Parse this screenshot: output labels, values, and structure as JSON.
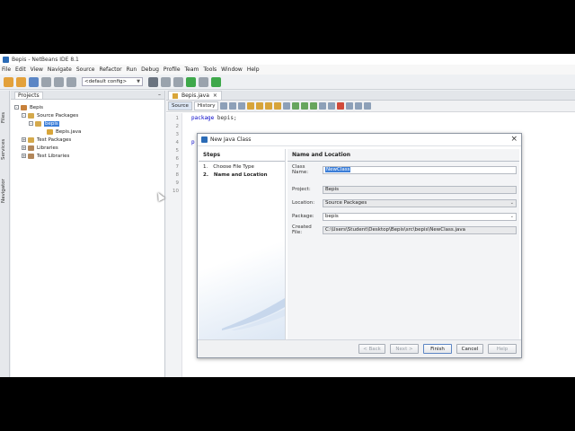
{
  "window": {
    "title": "Bepis - NetBeans IDE 8.1"
  },
  "menu": [
    "File",
    "Edit",
    "View",
    "Navigate",
    "Source",
    "Refactor",
    "Run",
    "Debug",
    "Profile",
    "Team",
    "Tools",
    "Window",
    "Help"
  ],
  "toolbar": {
    "config": "<default config>"
  },
  "side_tabs": {
    "files": "Files",
    "services": "Services",
    "navigator": "Navigator"
  },
  "projects": {
    "tab_label": "Projects",
    "tree": {
      "root": "Bepis",
      "source_packages": "Source Packages",
      "package": "bepis",
      "file": "Bepis.java",
      "test_packages": "Test Packages",
      "libraries": "Libraries",
      "test_libraries": "Test Libraries"
    }
  },
  "editor": {
    "tab": "Bepis.java",
    "mode_source": "Source",
    "mode_history": "History",
    "line_numbers": [
      "1",
      "2",
      "3",
      "4",
      "5",
      "6",
      "7",
      "8",
      "9",
      "10"
    ],
    "line1_kw": "package",
    "line1_rest": " bepis;",
    "line4_frag": "p"
  },
  "dialog": {
    "title": "New Java Class",
    "steps_header": "Steps",
    "steps": [
      {
        "num": "1.",
        "label": "Choose File Type"
      },
      {
        "num": "2.",
        "label": "Name and Location"
      }
    ],
    "panel_header": "Name and Location",
    "fields": {
      "class_name_label": "Class Name:",
      "class_name_value": "NewClass",
      "project_label": "Project:",
      "project_value": "Bepis",
      "location_label": "Location:",
      "location_value": "Source Packages",
      "package_label": "Package:",
      "package_value": "bepis",
      "created_file_label": "Created File:",
      "created_file_value": "C:\\Users\\Student\\Desktop\\Bepis\\src\\bepis\\NewClass.java"
    },
    "buttons": {
      "back": "< Back",
      "next": "Next >",
      "finish": "Finish",
      "cancel": "Cancel",
      "help": "Help"
    }
  }
}
